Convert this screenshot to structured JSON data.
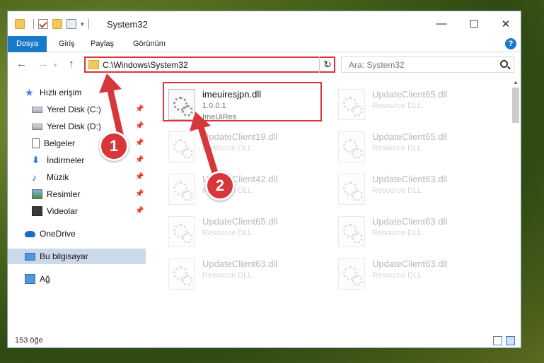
{
  "window": {
    "title": "System32"
  },
  "ribbon": {
    "tabs": [
      "Dosya",
      "Giriş",
      "Paylaş",
      "Görünüm"
    ],
    "help": "?"
  },
  "controls": {
    "minimize": "—",
    "maximize": "☐",
    "close": "✕"
  },
  "nav": {
    "back": "←",
    "forward": "→",
    "up": "↑",
    "refresh": "↻"
  },
  "address": {
    "path": "C:\\Windows\\System32",
    "chevron": "⌄"
  },
  "search": {
    "placeholder": "Ara: System32"
  },
  "sidebar": {
    "quick_access": "Hızlı erişim",
    "items": [
      {
        "label": "Yerel Disk (C:)",
        "icon": "disk-icon"
      },
      {
        "label": "Yerel Disk (D:)",
        "icon": "disk-icon"
      },
      {
        "label": "Belgeler",
        "icon": "documents-icon"
      },
      {
        "label": "İndirmeler",
        "icon": "downloads-icon"
      },
      {
        "label": "Müzik",
        "icon": "music-icon"
      },
      {
        "label": "Resimler",
        "icon": "pictures-icon"
      },
      {
        "label": "Videolar",
        "icon": "videos-icon"
      }
    ],
    "onedrive": "OneDrive",
    "this_pc": "Bu bilgisayar",
    "network": "Ağ",
    "pin": "📌"
  },
  "files": {
    "highlighted": {
      "name": "imeuiresjpn.dll",
      "version": "1.0.0.1",
      "desc": "ImeUiRes"
    },
    "tiles": [
      {
        "name": "UpdateClient65.dll",
        "desc": "Resource DLL"
      },
      {
        "name": "UpdateClient19.dll",
        "desc": "Resource DLL"
      },
      {
        "name": "UpdateClient65.dll",
        "desc": "Resource DLL"
      },
      {
        "name": "UpdateClient42.dll",
        "desc": "Resource DLL"
      },
      {
        "name": "UpdateClient63.dll",
        "desc": "Resource DLL"
      },
      {
        "name": "UpdateClient65.dll",
        "desc": "Resource DLL"
      },
      {
        "name": "UpdateClient63.dll",
        "desc": "Resource DLL"
      },
      {
        "name": "UpdateClient63.dll",
        "desc": "Resource DLL"
      },
      {
        "name": "UpdateClient63.dll",
        "desc": "Resource DLL"
      }
    ]
  },
  "status": {
    "count": "153 öğe"
  },
  "annotations": {
    "badge1": "1",
    "badge2": "2",
    "color": "#d7373b"
  }
}
